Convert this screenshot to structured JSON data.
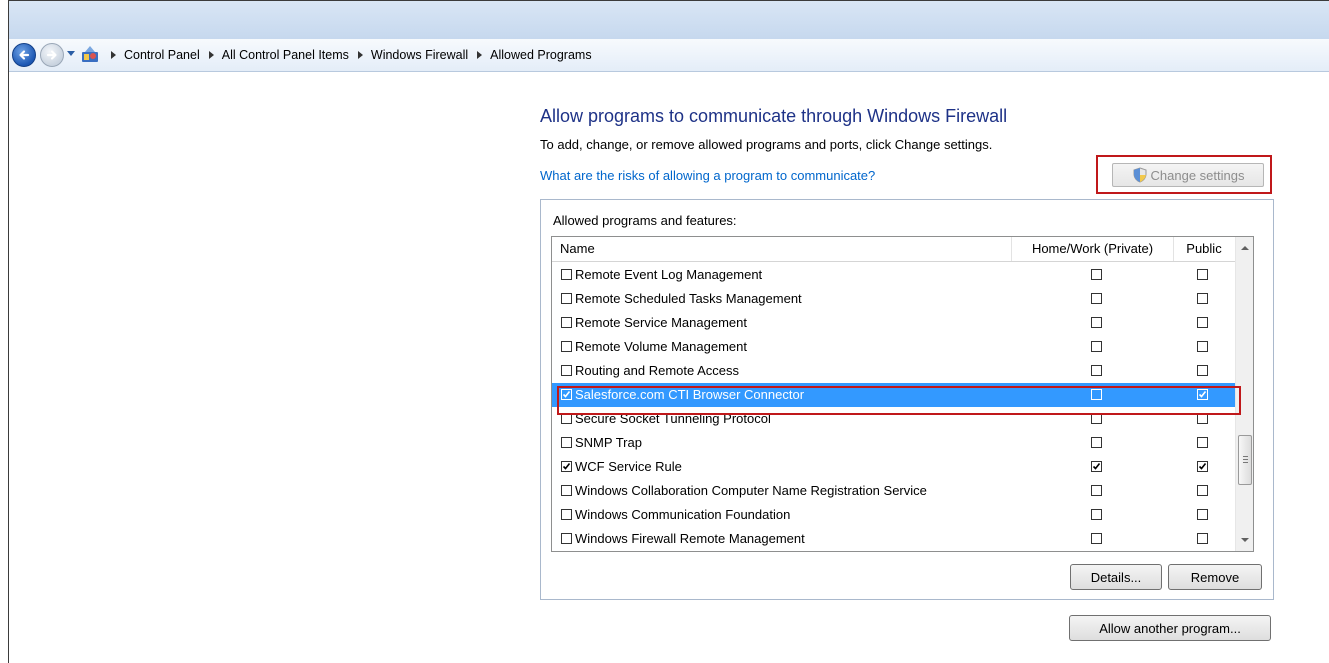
{
  "breadcrumb": {
    "items": [
      "Control Panel",
      "All Control Panel Items",
      "Windows Firewall",
      "Allowed Programs"
    ]
  },
  "main": {
    "title": "Allow programs to communicate through Windows Firewall",
    "subtitle": "To add, change, or remove allowed programs and ports, click Change settings.",
    "risk_link": "What are the risks of allowing a program to communicate?",
    "change_settings_label": "Change settings"
  },
  "programs": {
    "group_label": "Allowed programs and features:",
    "columns": {
      "name": "Name",
      "home": "Home/Work (Private)",
      "public": "Public"
    },
    "rows": [
      {
        "name": "Remote Event Log Management",
        "enabled": false,
        "home": false,
        "public": false
      },
      {
        "name": "Remote Scheduled Tasks Management",
        "enabled": false,
        "home": false,
        "public": false
      },
      {
        "name": "Remote Service Management",
        "enabled": false,
        "home": false,
        "public": false
      },
      {
        "name": "Remote Volume Management",
        "enabled": false,
        "home": false,
        "public": false
      },
      {
        "name": "Routing and Remote Access",
        "enabled": false,
        "home": false,
        "public": false
      },
      {
        "name": "Salesforce.com CTI Browser Connector",
        "enabled": true,
        "home": false,
        "public": true
      },
      {
        "name": "Secure Socket Tunneling Protocol",
        "enabled": false,
        "home": false,
        "public": false
      },
      {
        "name": "SNMP Trap",
        "enabled": false,
        "home": false,
        "public": false
      },
      {
        "name": "WCF Service Rule",
        "enabled": true,
        "home": true,
        "public": true
      },
      {
        "name": "Windows Collaboration Computer Name Registration Service",
        "enabled": false,
        "home": false,
        "public": false
      },
      {
        "name": "Windows Communication Foundation",
        "enabled": false,
        "home": false,
        "public": false
      },
      {
        "name": "Windows Firewall Remote Management",
        "enabled": false,
        "home": false,
        "public": false
      }
    ],
    "selected_row": "Salesforce.com CTI Browser Connector",
    "details_label": "Details...",
    "remove_label": "Remove",
    "allow_another_label": "Allow another program..."
  },
  "colors": {
    "title": "#1e3287",
    "link": "#0066cc",
    "selection": "#3399ff",
    "highlight_box": "#c0181a"
  }
}
